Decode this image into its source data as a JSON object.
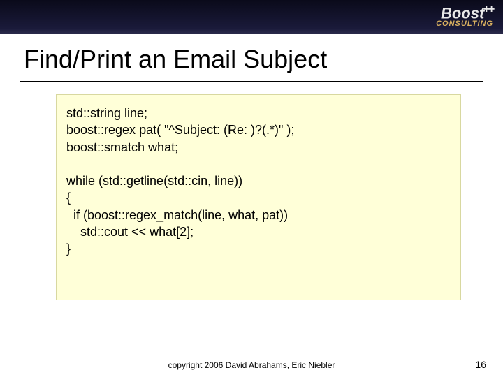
{
  "logo": {
    "brand": "Boost",
    "plus": "++",
    "subtitle": "CONSULTING"
  },
  "title": "Find/Print an Email Subject",
  "code": {
    "line1": "std::string line;",
    "line2": "boost::regex pat( \"^Subject: (Re: )?(.*)\" );",
    "line3": "boost::smatch what;",
    "blank1": "",
    "line4": "while (std::getline(std::cin, line))",
    "line5": "{",
    "line6": "  if (boost::regex_match(line, what, pat))",
    "line7": "    std::cout << what[2];",
    "line8": "}"
  },
  "footer": "copyright 2006 David Abrahams, Eric Niebler",
  "page_number": "16"
}
